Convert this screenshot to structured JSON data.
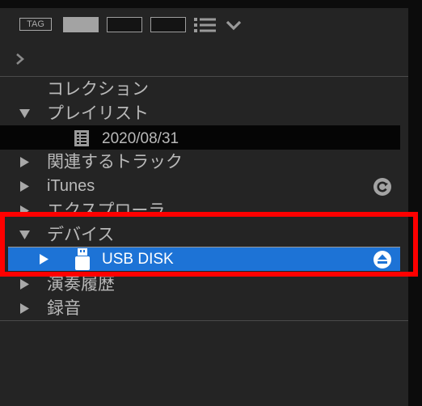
{
  "toolbar": {
    "tag_label": "TAG",
    "color_swatches": [
      "#a3a3a3",
      "#141414",
      "#141414"
    ],
    "icons": [
      "list-view-icon",
      "chevron-down-icon"
    ]
  },
  "nav": {
    "icon": "chevron-right-icon"
  },
  "tree": {
    "collection": {
      "label": "コレクション"
    },
    "playlists": {
      "label": "プレイリスト",
      "expanded": true
    },
    "playlist_item": {
      "label": "2020/08/31",
      "icon": "playlist-doc-icon"
    },
    "related_tracks": {
      "label": "関連するトラック",
      "expanded": false
    },
    "itunes": {
      "label": "iTunes",
      "expanded": false,
      "icon": "sync-icon"
    },
    "explorer": {
      "label": "エクスプローラ",
      "expanded": false
    },
    "devices": {
      "label": "デバイス",
      "expanded": true
    },
    "usb_disk": {
      "label": "USB DISK",
      "selected": true,
      "icon": "usb-drive-icon",
      "action_icon": "eject-icon"
    },
    "history": {
      "label": "演奏履歴",
      "expanded": false
    },
    "recording": {
      "label": "録音",
      "expanded": false
    }
  },
  "colors": {
    "selection": "#1d73d6",
    "highlight_annotation": "#ff0000",
    "background": "#242424",
    "text": "#b9b9b9"
  }
}
